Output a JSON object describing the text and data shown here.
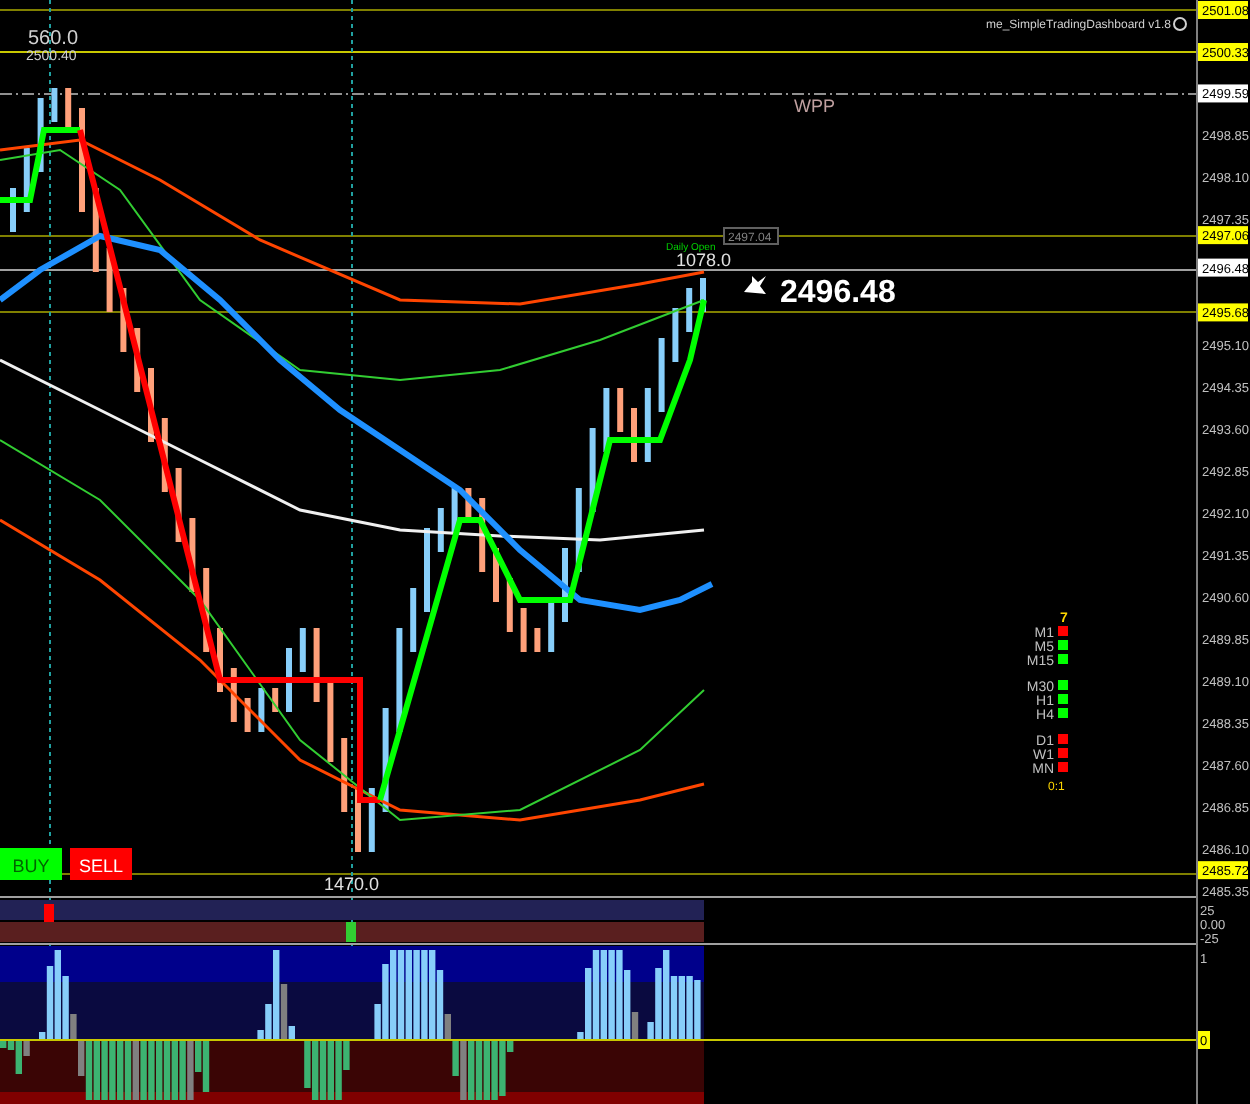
{
  "indicator_title": "me_SimpleTradingDashboard v1.8",
  "price_axis": [
    {
      "label": "2501.08",
      "kind": "marker"
    },
    {
      "label": "2500.33",
      "kind": "marker"
    },
    {
      "label": "2499.59",
      "kind": "line"
    },
    {
      "label": "2498.85",
      "kind": "tick"
    },
    {
      "label": "2498.10",
      "kind": "tick"
    },
    {
      "label": "2497.35",
      "kind": "tick"
    },
    {
      "label": "2497.06",
      "kind": "marker"
    },
    {
      "label": "2496.48",
      "kind": "line"
    },
    {
      "label": "2495.68",
      "kind": "marker"
    },
    {
      "label": "2495.10",
      "kind": "tick"
    },
    {
      "label": "2494.35",
      "kind": "tick"
    },
    {
      "label": "2493.60",
      "kind": "tick"
    },
    {
      "label": "2492.85",
      "kind": "tick"
    },
    {
      "label": "2492.10",
      "kind": "tick"
    },
    {
      "label": "2491.35",
      "kind": "tick"
    },
    {
      "label": "2490.60",
      "kind": "tick"
    },
    {
      "label": "2489.85",
      "kind": "tick"
    },
    {
      "label": "2489.10",
      "kind": "tick"
    },
    {
      "label": "2488.35",
      "kind": "tick"
    },
    {
      "label": "2487.60",
      "kind": "tick"
    },
    {
      "label": "2486.85",
      "kind": "tick"
    },
    {
      "label": "2486.10",
      "kind": "tick"
    },
    {
      "label": "2485.72",
      "kind": "marker"
    },
    {
      "label": "2485.35",
      "kind": "tick"
    }
  ],
  "indicator_axis": [
    {
      "label": "25",
      "kind": "tick"
    },
    {
      "label": "0.00",
      "kind": "tick"
    },
    {
      "label": "-25",
      "kind": "tick"
    },
    {
      "label": "1",
      "kind": "tick"
    },
    {
      "label": "0",
      "kind": "marker"
    }
  ],
  "chart_labels": {
    "top_count": "560.0",
    "top_price": "2500.40",
    "pivot": "WPP",
    "daily_open": "Daily Open",
    "daily_open_price": "2497.04",
    "current_count": "1078.0",
    "bid_price": "2496.48",
    "bottom_count": "1470.0"
  },
  "buttons": [
    {
      "label": "BUY",
      "kind": "buy"
    },
    {
      "label": "SELL",
      "kind": "sell"
    }
  ],
  "dashboard": {
    "score": "7",
    "ratio": "0:1",
    "groups": [
      [
        {
          "label": "M1",
          "color": "#ff0000"
        },
        {
          "label": "M5",
          "color": "#00ff00"
        },
        {
          "label": "M15",
          "color": "#00ff00"
        }
      ],
      [
        {
          "label": "M30",
          "color": "#00ff00"
        },
        {
          "label": "H1",
          "color": "#00ff00"
        },
        {
          "label": "H4",
          "color": "#00ff00"
        }
      ],
      [
        {
          "label": "D1",
          "color": "#ff0000"
        },
        {
          "label": "W1",
          "color": "#ff0000"
        },
        {
          "label": "MN",
          "color": "#ff0000"
        }
      ]
    ]
  }
}
